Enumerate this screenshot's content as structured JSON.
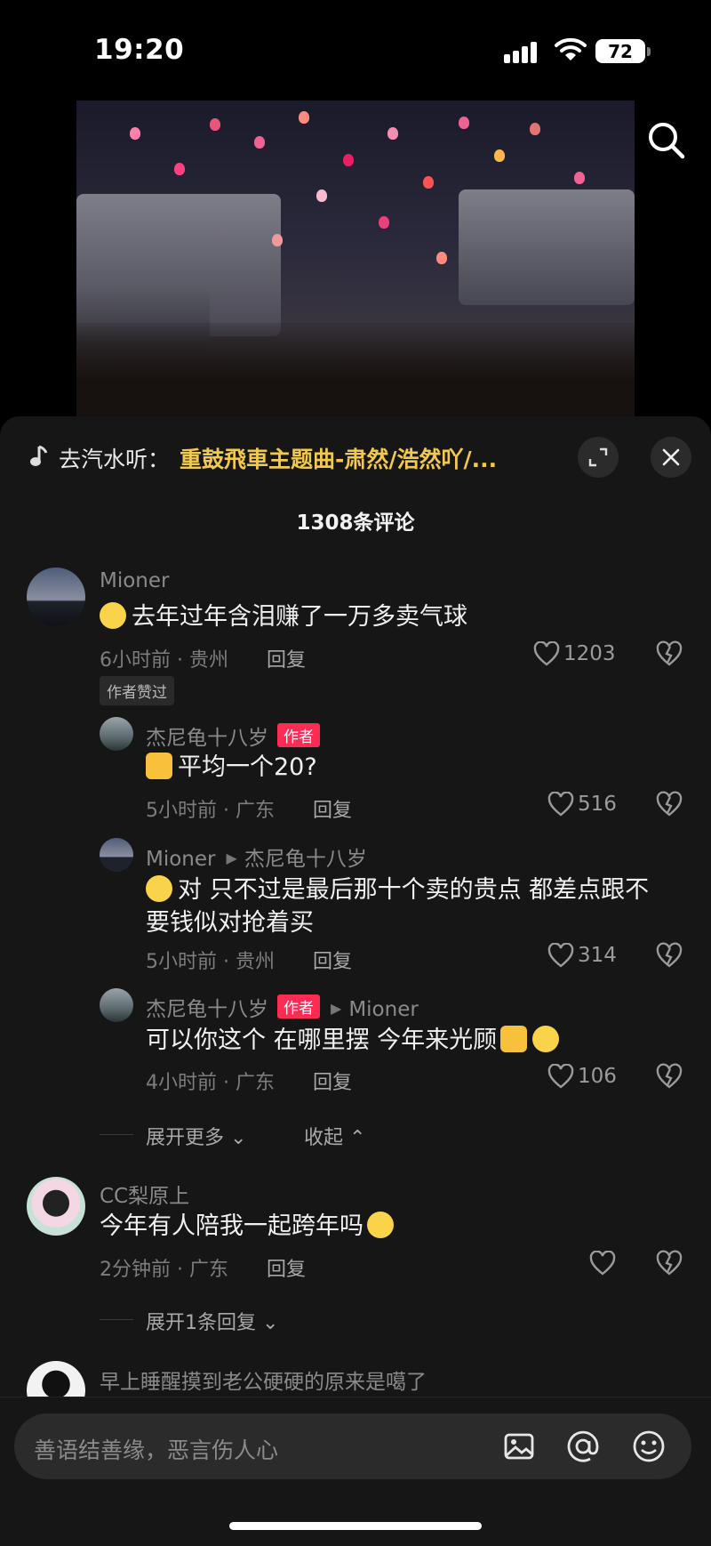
{
  "status": {
    "time": "19:20",
    "battery": "72"
  },
  "music": {
    "prefix": "去汽水听：",
    "title": "重鼓飛車主题曲-肃然/浩然吖/..."
  },
  "comments_count": "1308条评论",
  "comments": [
    {
      "user": "Mioner",
      "text": "去年过年含泪赚了一万多卖气球",
      "meta": "6小时前 · 贵州",
      "reply": "回复",
      "likes": "1203",
      "liked_by_author": "作者赞过"
    },
    {
      "user": "杰尼龟十八岁",
      "tag": "作者",
      "text": "平均一个20?",
      "meta": "5小时前 · 广东",
      "reply": "回复",
      "likes": "516"
    },
    {
      "user": "Mioner",
      "reply_to": "杰尼龟十八岁",
      "text_line1": "对   只不过是最后那十个卖的贵点  都差点跟不",
      "text_line2": "要钱似对抢着买",
      "meta": "5小时前 · 贵州",
      "reply": "回复",
      "likes": "314"
    },
    {
      "user": "杰尼龟十八岁",
      "tag": "作者",
      "reply_to": "Mioner",
      "text": "可以你这个 在哪里摆 今年来光顾",
      "meta": "4小时前 · 广东",
      "reply": "回复",
      "likes": "106"
    },
    {
      "user": "CC梨原上",
      "text": "今年有人陪我一起跨年吗",
      "meta": "2分钟前 · 广东",
      "reply": "回复"
    },
    {
      "text": "早上睡醒摸到老公硬硬的原来是噶了"
    }
  ],
  "expand_more": "展开更多",
  "collapse": "收起",
  "expand_one": "展开1条回复",
  "input": {
    "placeholder": "善语结善缘，恶言伤人心"
  },
  "colors": {
    "accent": "#fe2c55",
    "music_title": "#f2c94c",
    "sheet_bg": "#161616"
  },
  "icons": [
    "search-icon",
    "music-note-icon",
    "fullscreen-icon",
    "close-icon",
    "heart-icon",
    "dislike-icon",
    "image-icon",
    "at-icon",
    "emoji-icon"
  ]
}
